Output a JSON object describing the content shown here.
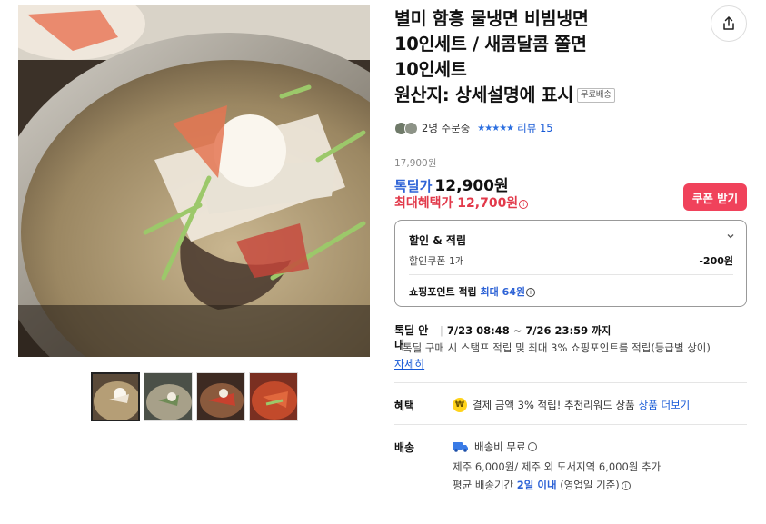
{
  "product": {
    "title_lines": [
      "별미 함흥 물냉면 비빔냉면",
      "10인세트 / 새콤달콤 쫄면",
      "10인세트",
      "원산지: 상세설명에 표시"
    ],
    "badge_free_shipping": "무료배송",
    "buyers_text": "2명 주문중",
    "stars": "★★★★★",
    "review_label": "리뷰 15",
    "original_price": "17,900원",
    "deal_label": "톡딜가",
    "deal_price": "12,900원",
    "max_benefit_label": "최대혜택가",
    "max_benefit_price": "12,700원",
    "info_icon": "ⓘ",
    "coupon_button": "쿠폰 받기"
  },
  "benefit_box": {
    "title": "할인 & 적립",
    "coupon_label": "할인쿠폰 1개",
    "coupon_value": "-200원",
    "point_prefix": "쇼핑포인트 적립",
    "point_highlight": "최대 64원"
  },
  "deal_info": {
    "label": "톡딜 안내",
    "period": "7/23 08:48 ~ 7/26 23:59 까지",
    "description": "톡딜 구매 시 스탬프 적립 및 최대 3% 쇼핑포인트를 적립(등급별 상이)",
    "more_link": "자세히"
  },
  "benefit_row": {
    "label": "혜택",
    "coin_symbol": "₩",
    "text": "결제 금액 3% 적립! 추천리워드 상품",
    "link": "상품 더보기"
  },
  "shipping": {
    "label": "배송",
    "fee": "배송비 무료",
    "extra": "제주 6,000원/ 제주 외 도서지역 6,000원 추가",
    "avg_prefix": "평균 배송기간",
    "avg_value": "2일 이내",
    "avg_suffix": "(영업일 기준)"
  },
  "colors": {
    "accent_blue": "#2e63d6",
    "link_blue": "#1558d6",
    "sale_red": "#e23a4b",
    "coupon_bg": "#f0425b"
  },
  "icons": {
    "share": "share-icon",
    "chevron": "chevron-down-icon",
    "truck": "truck-icon",
    "coin": "won-coin-icon"
  }
}
